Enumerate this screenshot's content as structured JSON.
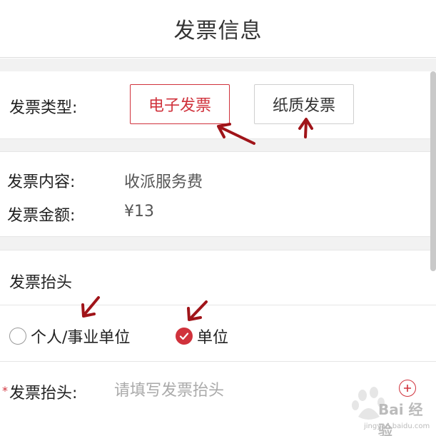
{
  "header": {
    "title": "发票信息"
  },
  "invoice_type": {
    "label": "发票类型:",
    "options": [
      {
        "label": "电子发票",
        "selected": true
      },
      {
        "label": "纸质发票",
        "selected": false
      }
    ]
  },
  "invoice_info": {
    "content_label": "发票内容:",
    "content_value": "收派服务费",
    "amount_label": "发票金额:",
    "amount_value": "¥13"
  },
  "invoice_title_section": {
    "heading": "发票抬头",
    "radio_options": [
      {
        "label": "个人/事业单位",
        "checked": false
      },
      {
        "label": "单位",
        "checked": true
      }
    ]
  },
  "title_field": {
    "required_mark": "*",
    "label": "发票抬头:",
    "placeholder": "请填写发票抬头",
    "value": ""
  },
  "watermark": {
    "text": "Bai  经验",
    "sub": "jingyan.baidu.com"
  },
  "colors": {
    "accent": "#d0323c",
    "annotation_arrow": "#a01419",
    "divider": "#e6e6e6",
    "gap": "#f2f2f2"
  }
}
